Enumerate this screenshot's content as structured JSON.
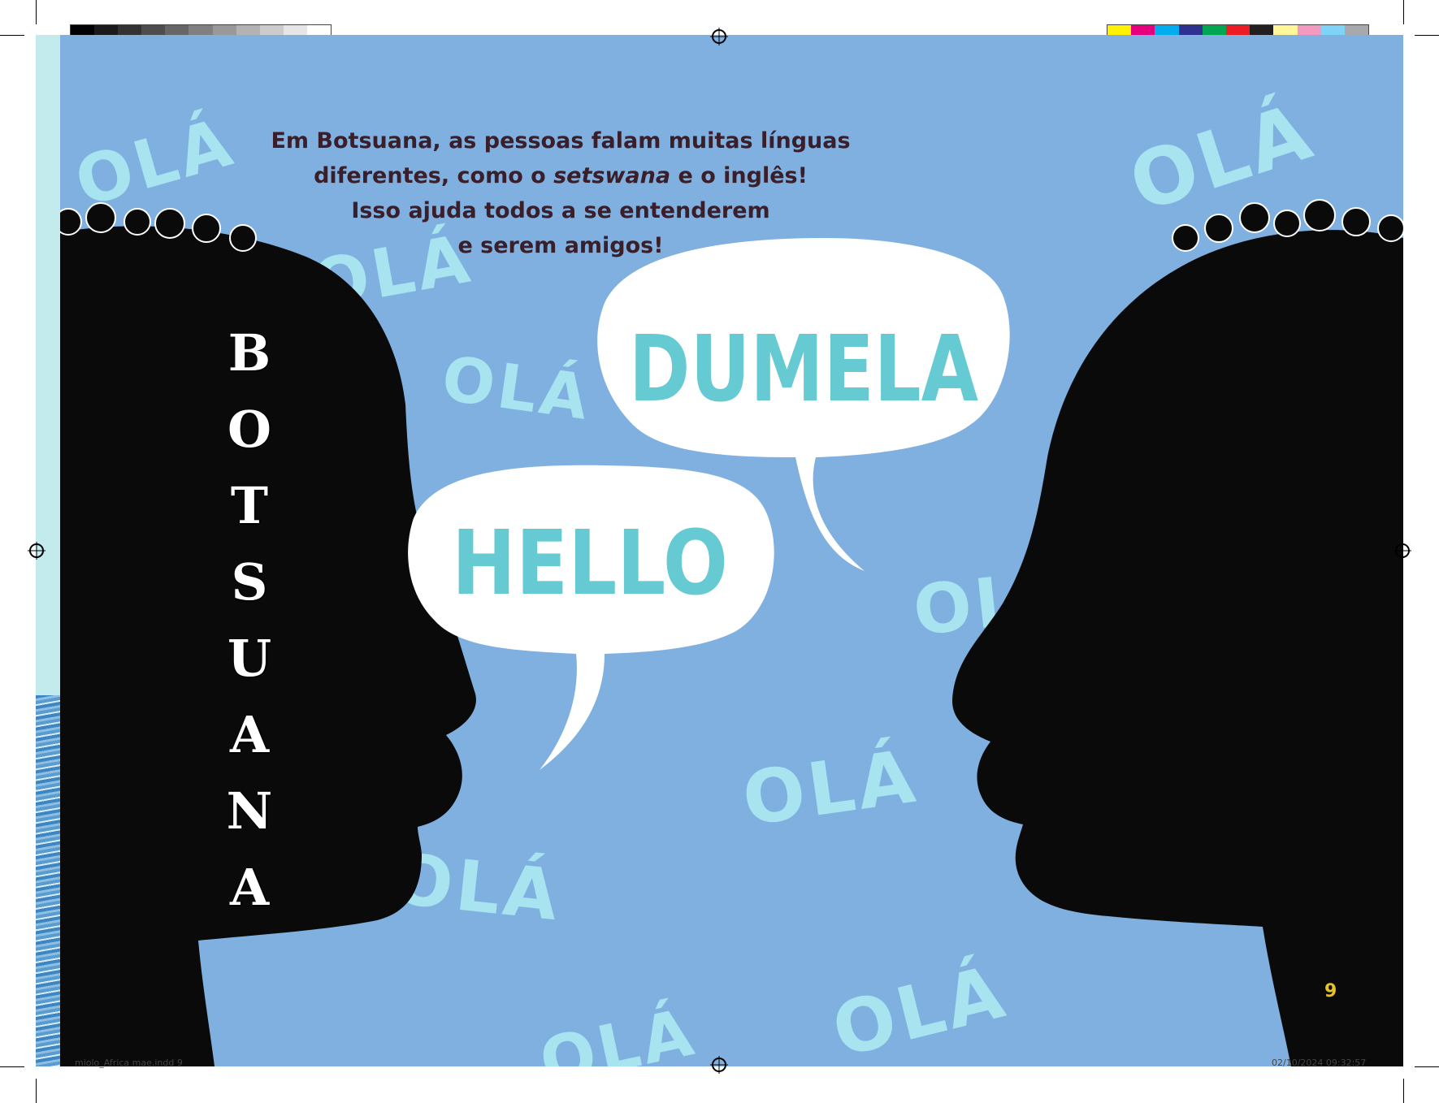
{
  "intro": {
    "line1": "Em Botsuana, as pessoas falam muitas línguas",
    "line2_a": "diferentes, como o ",
    "line2_word": "setswana",
    "line2_b": " e o inglês!",
    "line3": "Isso ajuda todos a se entenderem",
    "line4": "e serem amigos!"
  },
  "country_letters": [
    "B",
    "O",
    "T",
    "S",
    "U",
    "A",
    "N",
    "A"
  ],
  "bubbles": {
    "right": "DUMELA",
    "left": "HELLO"
  },
  "background_word": "OLÁ",
  "page_number": "9",
  "slug": {
    "file": "miolo_Africa mae.indd   9",
    "timestamp": "02/10/2024   09:32:57"
  },
  "colors": {
    "sky": "#7fb0e0",
    "silhouette": "#0a0a0a",
    "bubble": "#ffffff",
    "bubble_text": "#66cad3",
    "ola_text": "#a8e3f0",
    "intro_text": "#3a1f2a",
    "page_number": "#e6c22a"
  },
  "gray_swatches": [
    "#000000",
    "#1a1a1a",
    "#333333",
    "#4d4d4d",
    "#666666",
    "#808080",
    "#999999",
    "#b3b3b3",
    "#cccccc",
    "#e6e6e6",
    "#ffffff"
  ],
  "color_swatches": [
    "#fff200",
    "#e6007e",
    "#00aeef",
    "#2e3192",
    "#00a651",
    "#ed1c24",
    "#231f20",
    "#fff799",
    "#f49ac1",
    "#7fd3f7",
    "#a7a9ac"
  ]
}
